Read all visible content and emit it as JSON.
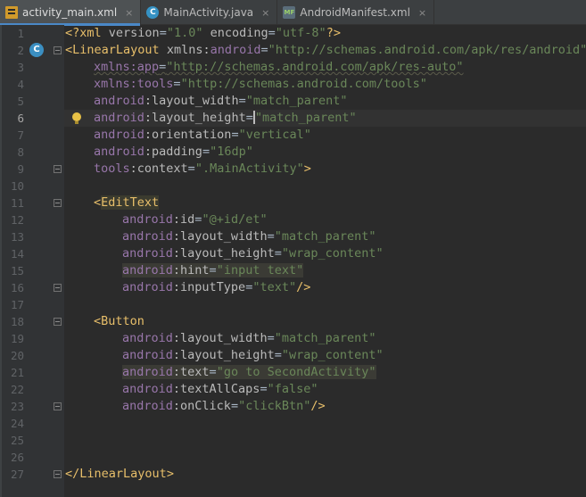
{
  "tabs": [
    {
      "label": "activity_main.xml",
      "icon": "xml-file-icon",
      "active": true
    },
    {
      "label": "MainActivity.java",
      "icon": "java-class-icon",
      "active": false
    },
    {
      "label": "AndroidManifest.xml",
      "icon": "manifest-file-icon",
      "active": false
    }
  ],
  "tab_close_glyph": "×",
  "gutter_badge": "C",
  "current_line": 6,
  "colors": {
    "background": "#2b2b2b",
    "gutter": "#313335",
    "tag": "#e8bf6a",
    "namespace": "#9876aa",
    "attribute": "#bababa",
    "string": "#6a8759",
    "text": "#a9b7c6",
    "accent": "#4a88c7"
  },
  "lines": [
    {
      "n": 1,
      "segments": [
        [
          "tag",
          "<?"
        ],
        [
          "tagname",
          "xml "
        ],
        [
          "attr",
          "version"
        ],
        [
          "text",
          "="
        ],
        [
          "str",
          "\"1.0\" "
        ],
        [
          "attr",
          "encoding"
        ],
        [
          "text",
          "="
        ],
        [
          "str",
          "\"utf-8\""
        ],
        [
          "tag",
          "?>"
        ]
      ]
    },
    {
      "n": 2,
      "badge": true,
      "fold": true,
      "segments": [
        [
          "tag",
          "<"
        ],
        [
          "tagname",
          "LinearLayout "
        ],
        [
          "attr",
          "xmlns:"
        ],
        [
          "ns",
          "android"
        ],
        [
          "text",
          "="
        ],
        [
          "str",
          "\"http://schemas.android.com/apk/res/android\""
        ]
      ]
    },
    {
      "n": 3,
      "indent": 1,
      "segments": [
        [
          "ns",
          "xmlns:app"
        ],
        [
          "text",
          "="
        ],
        [
          "str",
          "\"http://schemas.android.com/apk/res-auto\""
        ]
      ],
      "underline": true
    },
    {
      "n": 4,
      "indent": 1,
      "segments": [
        [
          "ns",
          "xmlns:"
        ],
        [
          "ns",
          "tools"
        ],
        [
          "text",
          "="
        ],
        [
          "str",
          "\"http://schemas.android.com/tools\""
        ]
      ]
    },
    {
      "n": 5,
      "indent": 1,
      "segments": [
        [
          "ns",
          "android"
        ],
        [
          "attr",
          ":layout_width"
        ],
        [
          "text",
          "="
        ],
        [
          "str",
          "\"match_parent\""
        ]
      ]
    },
    {
      "n": 6,
      "indent": 1,
      "lamp": true,
      "caret": true,
      "segments": [
        [
          "ns",
          "android"
        ],
        [
          "attr",
          ":layout_height"
        ],
        [
          "text",
          "="
        ],
        [
          "str",
          "\"match_parent\""
        ]
      ]
    },
    {
      "n": 7,
      "indent": 1,
      "segments": [
        [
          "ns",
          "android"
        ],
        [
          "attr",
          ":orientation"
        ],
        [
          "text",
          "="
        ],
        [
          "str",
          "\"vertical\""
        ]
      ]
    },
    {
      "n": 8,
      "indent": 1,
      "segments": [
        [
          "ns",
          "android"
        ],
        [
          "attr",
          ":padding"
        ],
        [
          "text",
          "="
        ],
        [
          "str",
          "\"16dp\""
        ]
      ]
    },
    {
      "n": 9,
      "indent": 1,
      "fold": true,
      "segments": [
        [
          "ns",
          "tools"
        ],
        [
          "attr",
          ":context"
        ],
        [
          "text",
          "="
        ],
        [
          "str",
          "\".MainActivity\""
        ],
        [
          "tag",
          ">"
        ]
      ]
    },
    {
      "n": 10,
      "segments": []
    },
    {
      "n": 11,
      "indent": 1,
      "fold": true,
      "segments": [
        [
          "tag",
          "<"
        ],
        [
          "taghl",
          "EditText"
        ]
      ]
    },
    {
      "n": 12,
      "indent": 2,
      "segments": [
        [
          "ns",
          "android"
        ],
        [
          "attr",
          ":id"
        ],
        [
          "text",
          "="
        ],
        [
          "str",
          "\"@+id/et\""
        ]
      ]
    },
    {
      "n": 13,
      "indent": 2,
      "segments": [
        [
          "ns",
          "android"
        ],
        [
          "attr",
          ":layout_width"
        ],
        [
          "text",
          "="
        ],
        [
          "str",
          "\"match_parent\""
        ]
      ]
    },
    {
      "n": 14,
      "indent": 2,
      "segments": [
        [
          "ns",
          "android"
        ],
        [
          "attr",
          ":layout_height"
        ],
        [
          "text",
          "="
        ],
        [
          "str",
          "\"wrap_content\""
        ]
      ]
    },
    {
      "n": 15,
      "indent": 2,
      "highlight": true,
      "segments": [
        [
          "ns",
          "android"
        ],
        [
          "attr",
          ":hint"
        ],
        [
          "text",
          "="
        ],
        [
          "str",
          "\"input text\""
        ]
      ]
    },
    {
      "n": 16,
      "indent": 2,
      "fold": true,
      "segments": [
        [
          "ns",
          "android"
        ],
        [
          "attr",
          ":inputType"
        ],
        [
          "text",
          "="
        ],
        [
          "str",
          "\"text\""
        ],
        [
          "tag",
          "/>"
        ]
      ]
    },
    {
      "n": 17,
      "segments": []
    },
    {
      "n": 18,
      "indent": 1,
      "fold": true,
      "segments": [
        [
          "tag",
          "<"
        ],
        [
          "tagname",
          "Button"
        ]
      ]
    },
    {
      "n": 19,
      "indent": 2,
      "segments": [
        [
          "ns",
          "android"
        ],
        [
          "attr",
          ":layout_width"
        ],
        [
          "text",
          "="
        ],
        [
          "str",
          "\"match_parent\""
        ]
      ]
    },
    {
      "n": 20,
      "indent": 2,
      "segments": [
        [
          "ns",
          "android"
        ],
        [
          "attr",
          ":layout_height"
        ],
        [
          "text",
          "="
        ],
        [
          "str",
          "\"wrap_content\""
        ]
      ]
    },
    {
      "n": 21,
      "indent": 2,
      "highlight": true,
      "segments": [
        [
          "ns",
          "android"
        ],
        [
          "attr",
          ":text"
        ],
        [
          "text",
          "="
        ],
        [
          "str",
          "\"go to SecondActivity\""
        ]
      ]
    },
    {
      "n": 22,
      "indent": 2,
      "segments": [
        [
          "ns",
          "android"
        ],
        [
          "attr",
          ":textAllCaps"
        ],
        [
          "text",
          "="
        ],
        [
          "str",
          "\"false\""
        ]
      ]
    },
    {
      "n": 23,
      "indent": 2,
      "fold": true,
      "segments": [
        [
          "ns",
          "android"
        ],
        [
          "attr",
          ":onClick"
        ],
        [
          "text",
          "="
        ],
        [
          "str",
          "\"clickBtn\""
        ],
        [
          "tag",
          "/>"
        ]
      ]
    },
    {
      "n": 24,
      "segments": []
    },
    {
      "n": 25,
      "segments": []
    },
    {
      "n": 26,
      "segments": []
    },
    {
      "n": 27,
      "fold": true,
      "segments": [
        [
          "tag",
          "</"
        ],
        [
          "tagname",
          "LinearLayout"
        ],
        [
          "tag",
          ">"
        ]
      ]
    }
  ]
}
